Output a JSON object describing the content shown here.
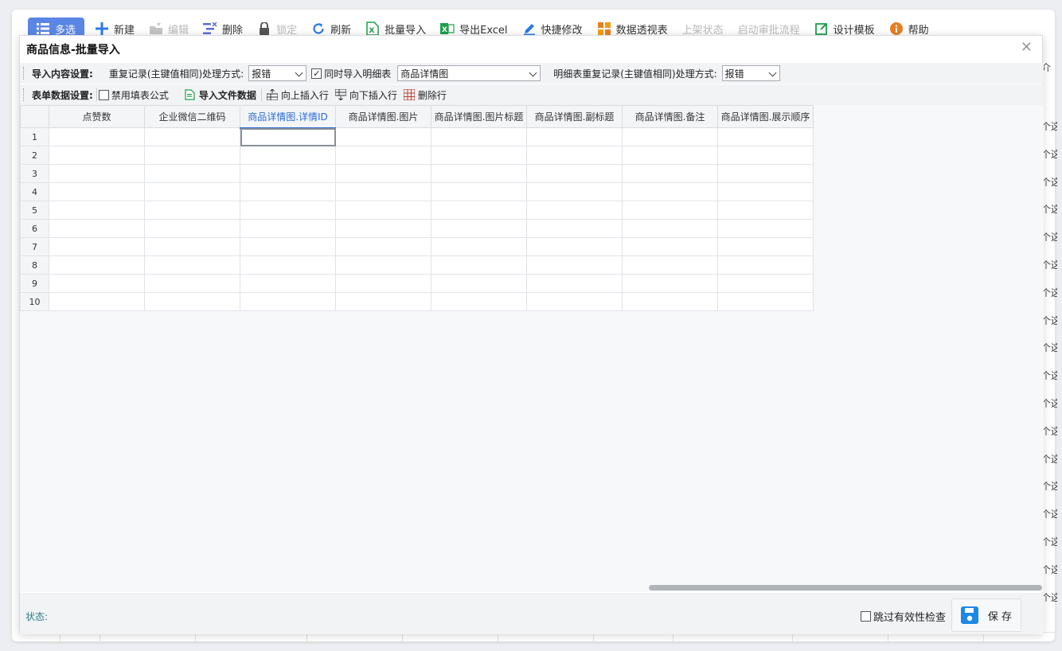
{
  "toolbar": {
    "multi_select": "多选",
    "new": "新建",
    "edit": "编辑",
    "delete": "删除",
    "lock": "锁定",
    "refresh": "刷新",
    "batch_import": "批量导入",
    "export_excel": "导出Excel",
    "quick_edit": "快捷修改",
    "pivot_table": "数据透视表",
    "shelf_status": "上架状态",
    "start_approval": "启动审批流程",
    "design_template": "设计模板",
    "help": "帮助"
  },
  "background_list": {
    "header_fragment": "介",
    "cell_fragment": "个这"
  },
  "dialog": {
    "title": "商品信息-批量导入",
    "row1": {
      "section_label": "导入内容设置:",
      "duplicate_label": "重复记录(主键值相同)处理方式:",
      "duplicate_value": "报错",
      "import_detail_label": "同时导入明细表",
      "import_detail_checked": true,
      "detail_table_value": "商品详情图",
      "detail_duplicate_label": "明细表重复记录(主键值相同)处理方式:",
      "detail_duplicate_value": "报错"
    },
    "row2": {
      "section_label": "表单数据设置:",
      "disable_formula_label": "禁用填表公式",
      "disable_formula_checked": false,
      "import_file_label": "导入文件数据",
      "insert_above_label": "向上插入行",
      "insert_below_label": "向下插入行",
      "delete_row_label": "删除行"
    },
    "grid": {
      "columns": [
        "点赞数",
        "企业微信二维码",
        "商品详情图.详情ID",
        "商品详情图.图片",
        "商品详情图.图片标题",
        "商品详情图.副标题",
        "商品详情图.备注",
        "商品详情图.展示顺序"
      ],
      "active_column_index": 2,
      "row_numbers": [
        "1",
        "2",
        "3",
        "4",
        "5",
        "6",
        "7",
        "8",
        "9",
        "10"
      ]
    },
    "footer": {
      "status_label": "状态:",
      "skip_validation_label": "跳过有效性检查",
      "skip_validation_checked": false,
      "save_label": "保 存"
    }
  },
  "colors": {
    "primary": "#5b86e5",
    "accent_blue": "#2a6bd5",
    "status_teal": "#2a7f86"
  }
}
